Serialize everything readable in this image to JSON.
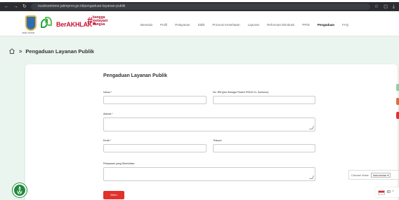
{
  "browser": {
    "url": "rsudrsoetomo.jatimprov.go.id/pengaduan-layanan-publik"
  },
  "header": {
    "crest_caption": "JAWA TIMUR",
    "berakhlak": "BerAKHLAK",
    "bangga_line1": "bangga",
    "bangga_line2": "melayani",
    "bangga_line3": "bangsa",
    "nav": [
      "Beranda",
      "Profil",
      "Pelayanan",
      "Diklit",
      "Promosi Kesehatan",
      "Laporan",
      "Reformasi Birokrasi",
      "PPID",
      "Pengaduan",
      "FAQ"
    ],
    "active_nav": "Pengaduan"
  },
  "breadcrumb": {
    "separator": ">",
    "current": "Pengaduan Layanan Publik"
  },
  "form": {
    "title": "Pengaduan Layanan Publik",
    "nama_label": "Nama *",
    "norm_label": "No. RM (jika Sebagai Pasien RSUD Dr. Soetomo)",
    "alamat_label": "Alamat *",
    "email_label": "Email *",
    "telepon_label": "Telepon",
    "pelayanan_label": "Pelayanan yang Dikeluhkan",
    "submit_label": "Kirim"
  },
  "widgets": {
    "voice_label": "Choose Voice",
    "voice_value": "Indonesian ▾",
    "lang_code": "ID ⌃"
  },
  "colors": {
    "accent_green": "#1f8a3c",
    "brand_red": "#c8102e",
    "submit_red": "#e2312b"
  }
}
